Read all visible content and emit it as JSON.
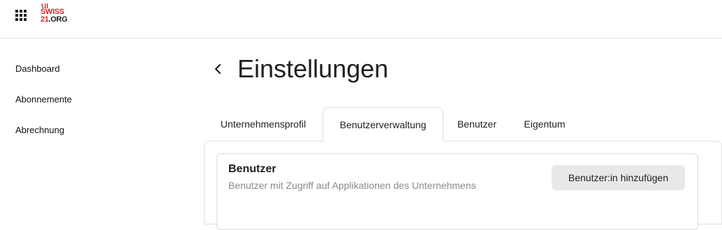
{
  "header": {
    "logo_top": "SWISS",
    "logo_bottom_num": "21",
    "logo_bottom_rest": ".ORG",
    "apps_icon": "grid-icon"
  },
  "sidebar": {
    "items": [
      {
        "label": "Dashboard"
      },
      {
        "label": "Abonnemente"
      },
      {
        "label": "Abrechnung"
      }
    ]
  },
  "page": {
    "back_icon": "chevron-left-icon",
    "title": "Einstellungen"
  },
  "tabs": [
    {
      "label": "Unternehmensprofil",
      "active": false
    },
    {
      "label": "Benutzerverwaltung",
      "active": true
    },
    {
      "label": "Benutzer",
      "active": false
    },
    {
      "label": "Eigentum",
      "active": false
    }
  ],
  "users_card": {
    "title": "Benutzer",
    "subtitle": "Benutzer mit Zugriff auf Applikationen des Unternehmens",
    "add_button_label": "Benutzer:in hinzufügen"
  },
  "colors": {
    "brand_red": "#d62828",
    "border": "#dcdcdc",
    "button_bg": "#e8e8e8",
    "muted_text": "#8a8a8a"
  }
}
